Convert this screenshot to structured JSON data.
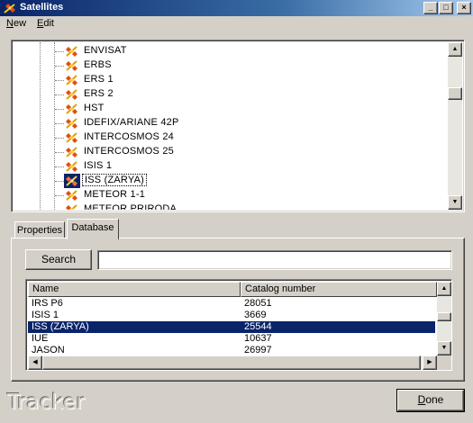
{
  "window": {
    "title": "Satellites",
    "controls": {
      "minimize": "_",
      "maximize": "□",
      "close": "×"
    }
  },
  "menu": {
    "items": [
      "New",
      "Edit"
    ]
  },
  "tree": {
    "items": [
      {
        "label": "ENVISAT"
      },
      {
        "label": "ERBS"
      },
      {
        "label": "ERS 1"
      },
      {
        "label": "ERS 2"
      },
      {
        "label": "HST"
      },
      {
        "label": "IDEFIX/ARIANE 42P"
      },
      {
        "label": "INTERCOSMOS 24"
      },
      {
        "label": "INTERCOSMOS 25"
      },
      {
        "label": "ISIS 1"
      },
      {
        "label": "ISS (ZARYA)",
        "selected": true
      },
      {
        "label": "METEOR 1-1"
      },
      {
        "label": "METEOR PRIRODA"
      }
    ]
  },
  "tabs": {
    "properties": "Properties",
    "database": "Database",
    "active": "Database"
  },
  "search": {
    "button_label": "Search",
    "input_value": ""
  },
  "list": {
    "columns": [
      "Name",
      "Catalog number"
    ],
    "rows": [
      {
        "name": "IRS P6",
        "catalog": "28051"
      },
      {
        "name": "ISIS 1",
        "catalog": "3669"
      },
      {
        "name": "ISS (ZARYA)",
        "catalog": "25544",
        "selected": true
      },
      {
        "name": "IUE",
        "catalog": "10637"
      },
      {
        "name": "JASON",
        "catalog": "26997"
      }
    ]
  },
  "footer": {
    "brand": "Tracker",
    "done_label": "Done"
  },
  "colors": {
    "selection": "#0a246a",
    "face": "#d4d0c8",
    "title_gradient_start": "#0a246a"
  },
  "icons": {
    "app": "satellite-icon",
    "tree_item": "satellite-icon"
  }
}
